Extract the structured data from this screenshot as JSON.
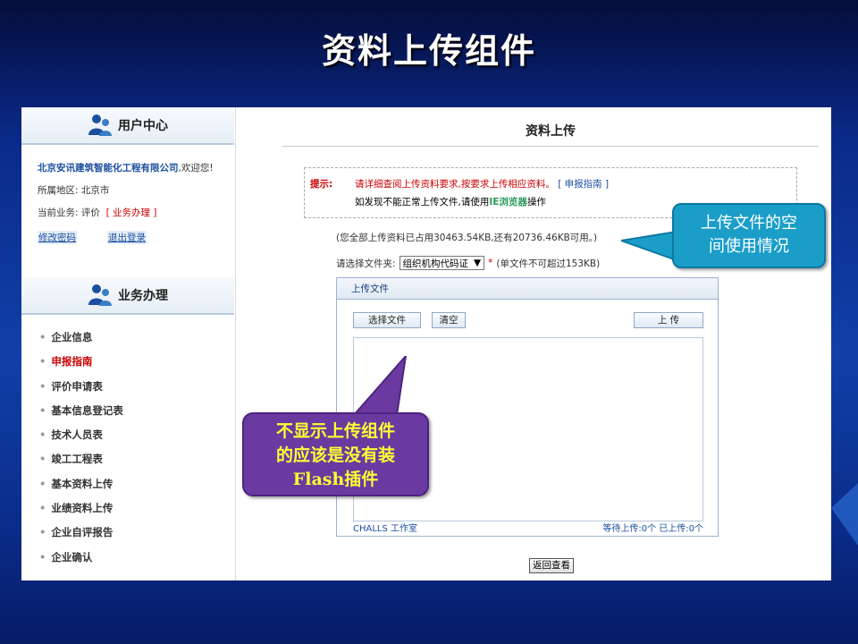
{
  "slide": {
    "title": "资料上传组件"
  },
  "sidebar": {
    "user_center_title": "用户中心",
    "company": "北京安讯建筑智能化工程有限公司",
    "welcome": ",欢迎您!",
    "region_label": "所属地区:",
    "region_value": "北京市",
    "business_label": "当前业务:",
    "business_value": "评价",
    "business_link": "业务办理",
    "change_password": "修改密码",
    "logout": "退出登录",
    "business_title": "业务办理",
    "menu": [
      "企业信息",
      "申报指南",
      "评价申请表",
      "基本信息登记表",
      "技术人员表",
      "竣工工程表",
      "基本资料上传",
      "业绩资料上传",
      "企业自评报告",
      "企业确认"
    ]
  },
  "main": {
    "title": "资料上传",
    "notice": {
      "label": "提示:",
      "line1": "请详细查阅上传资料要求,按要求上传相应资料。",
      "guide_link": "申报指南",
      "line2_prefix": "如发现不能正常上传文件,请使用",
      "browser": "IE浏览器",
      "line2_suffix": "操作"
    },
    "usage": "(您全部上传资料已占用30463.54KB,还有20736.46KB可用。)",
    "folder_label": "请选择文件夹:",
    "folder_value": "组织机构代码证",
    "folder_note": "(单文件不可超过153KB)",
    "upload": {
      "header": "上传文件",
      "select_button": "选择文件",
      "clear_button": "清空",
      "upload_button": "上 传",
      "footer_left": "CHALLS 工作室",
      "footer_right": "等待上传:0个  已上传:0个"
    },
    "back_button": "返回查看"
  },
  "callouts": {
    "space_line1": "上传文件的空",
    "space_line2": "间使用情况",
    "flash_line1": "不显示上传组件",
    "flash_line2": "的应该是没有装",
    "flash_line3": "Flash插件"
  }
}
